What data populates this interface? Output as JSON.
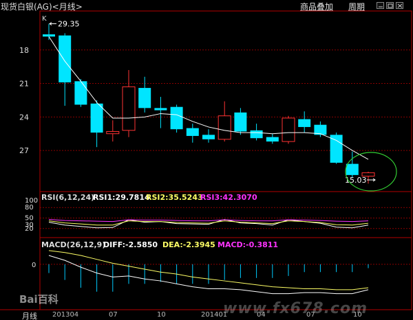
{
  "window": {
    "title": "现货白银(AG)<月线>",
    "menu": {
      "overlay": "商品叠加",
      "period": "周期"
    }
  },
  "colors": {
    "up": "#ff3333",
    "down": "#00e5ff",
    "grid": "#8b0000",
    "frame": "#b30000",
    "ma": "#ffffff",
    "rsi1": "#ffffff",
    "rsi2": "#ffff66",
    "rsi3": "#ff33ff",
    "diff": "#ffffff",
    "dea": "#ffff66",
    "hist": "#00ccff",
    "circle": "#33cc33"
  },
  "kline": {
    "label": "K",
    "high_label": "29.35",
    "low_label": "15.03",
    "y_ticks": [
      "27",
      "24",
      "21",
      "18"
    ]
  },
  "chart_data": [
    {
      "type": "candlestick",
      "title": "现货白银(AG)<月线>",
      "ylim": [
        14.5,
        30.0
      ],
      "y_ticks": [
        18,
        21,
        24,
        27
      ],
      "x_ticks": [
        "201304",
        "07",
        "10",
        "201401",
        "04",
        "07",
        "10"
      ],
      "candles": [
        {
          "o": 28.4,
          "h": 29.35,
          "l": 27.9,
          "c": 28.2
        },
        {
          "o": 28.3,
          "h": 28.5,
          "l": 22.0,
          "c": 24.1
        },
        {
          "o": 24.2,
          "h": 24.4,
          "l": 21.9,
          "c": 22.1
        },
        {
          "o": 22.2,
          "h": 22.5,
          "l": 18.3,
          "c": 19.6
        },
        {
          "o": 19.5,
          "h": 20.7,
          "l": 18.8,
          "c": 19.7
        },
        {
          "o": 19.8,
          "h": 25.2,
          "l": 19.2,
          "c": 23.7
        },
        {
          "o": 23.6,
          "h": 24.6,
          "l": 21.4,
          "c": 21.8
        },
        {
          "o": 21.8,
          "h": 22.8,
          "l": 20.0,
          "c": 21.6
        },
        {
          "o": 21.9,
          "h": 22.1,
          "l": 19.6,
          "c": 19.9
        },
        {
          "o": 20.0,
          "h": 20.4,
          "l": 18.7,
          "c": 19.3
        },
        {
          "o": 19.4,
          "h": 19.9,
          "l": 18.7,
          "c": 19.0
        },
        {
          "o": 19.0,
          "h": 22.4,
          "l": 18.8,
          "c": 21.1
        },
        {
          "o": 21.4,
          "h": 21.8,
          "l": 19.4,
          "c": 19.7
        },
        {
          "o": 19.8,
          "h": 20.4,
          "l": 18.9,
          "c": 19.1
        },
        {
          "o": 19.2,
          "h": 19.5,
          "l": 18.6,
          "c": 18.8
        },
        {
          "o": 18.8,
          "h": 21.1,
          "l": 18.6,
          "c": 20.9
        },
        {
          "o": 20.8,
          "h": 21.5,
          "l": 19.6,
          "c": 20.1
        },
        {
          "o": 20.3,
          "h": 20.6,
          "l": 19.2,
          "c": 19.4
        },
        {
          "o": 19.4,
          "h": 19.6,
          "l": 16.8,
          "c": 16.9
        },
        {
          "o": 16.8,
          "h": 17.9,
          "l": 15.6,
          "c": 15.8
        },
        {
          "o": 15.7,
          "h": 16.1,
          "l": 15.03,
          "c": 16.0
        }
      ],
      "ma": [
        28.2,
        26.0,
        24.2,
        22.3,
        20.9,
        20.9,
        21.0,
        21.3,
        21.2,
        20.6,
        20.1,
        19.8,
        19.6,
        19.6,
        19.5,
        19.6,
        19.6,
        19.5,
        18.9,
        18.0,
        17.2
      ]
    },
    {
      "type": "line",
      "title": "RSI(6,12,24)",
      "ylim": [
        0,
        100
      ],
      "y_ticks": [
        20,
        30,
        50,
        80,
        100
      ],
      "series": [
        {
          "name": "RSI1",
          "label": "RSI1:29.7814",
          "values": [
            38,
            30,
            26,
            22,
            23,
            45,
            38,
            40,
            34,
            33,
            32,
            46,
            36,
            34,
            30,
            45,
            40,
            35,
            24,
            22,
            30
          ]
        },
        {
          "name": "RSI2",
          "label": "RSI2:35.5243",
          "values": [
            42,
            36,
            33,
            30,
            30,
            42,
            40,
            40,
            37,
            36,
            35,
            42,
            38,
            36,
            34,
            42,
            40,
            37,
            31,
            30,
            35
          ]
        },
        {
          "name": "RSI3",
          "label": "RSI3:42.3070",
          "values": [
            46,
            43,
            42,
            41,
            40,
            45,
            44,
            44,
            43,
            42,
            42,
            45,
            43,
            42,
            42,
            45,
            44,
            43,
            41,
            40,
            42
          ]
        }
      ]
    },
    {
      "type": "line",
      "title": "MACD(26,12,9)",
      "y_ticks": [
        0
      ],
      "ylim": [
        -4.5,
        1.6
      ],
      "series": [
        {
          "name": "DIFF",
          "label": "DIFF:-2.5850",
          "values": [
            0.9,
            0.4,
            -0.3,
            -0.9,
            -1.3,
            -1.2,
            -1.5,
            -1.7,
            -2.0,
            -2.3,
            -2.5,
            -2.5,
            -2.6,
            -2.8,
            -3.0,
            -3.0,
            -2.9,
            -2.9,
            -3.0,
            -3.0,
            -2.6
          ]
        },
        {
          "name": "DEA",
          "label": "DEA:-2.3945",
          "values": [
            1.4,
            1.2,
            0.9,
            0.5,
            0.1,
            -0.2,
            -0.5,
            -0.8,
            -1.0,
            -1.3,
            -1.5,
            -1.7,
            -1.9,
            -2.1,
            -2.3,
            -2.4,
            -2.5,
            -2.5,
            -2.6,
            -2.6,
            -2.4
          ]
        },
        {
          "name": "MACD",
          "label": "MACD:-0.3811",
          "values": [
            -0.9,
            -1.6,
            -2.4,
            -2.8,
            -2.8,
            -2.0,
            -2.0,
            -1.8,
            -2.0,
            -2.0,
            -2.0,
            -1.6,
            -1.4,
            -1.4,
            -1.4,
            -1.2,
            -0.8,
            -0.8,
            -0.8,
            -0.8,
            -0.4
          ]
        }
      ]
    }
  ],
  "rsi": {
    "title": "RSI(6,12,24)",
    "rsi1": "RSI1:29.7814",
    "rsi2": "RSI2:35.5243",
    "rsi3": "RSI3:42.3070",
    "y_ticks": [
      "100",
      "80",
      "50",
      "30",
      "20"
    ]
  },
  "macd": {
    "title": "MACD(26,12,9)",
    "diff": "DIFF:-2.5850",
    "dea": "DEA:-2.3945",
    "macd": "MACD:-0.3811",
    "zero_tick": "0"
  },
  "xaxis": {
    "name": "月线",
    "ticks": [
      "201304",
      "07",
      "10",
      "201401",
      "04",
      "07",
      "10"
    ]
  },
  "watermark": "www.fx678.com",
  "baidu": "Bai百科"
}
